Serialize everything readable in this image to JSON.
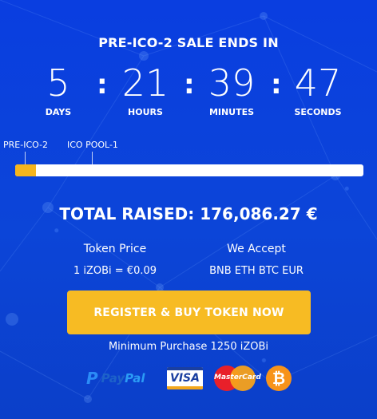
{
  "heading": "PRE-ICO-2 SALE ENDS IN",
  "countdown": {
    "days": {
      "value": "5",
      "label": "DAYS"
    },
    "hours": {
      "value": "21",
      "label": "HOURS"
    },
    "minutes": {
      "value": "39",
      "label": "MINUTES"
    },
    "seconds": {
      "value": "47",
      "label": "SECONDS"
    },
    "separator": ":"
  },
  "stages": [
    "PRE-ICO-2",
    "ICO POOL-1"
  ],
  "progress": {
    "fraction": 0.06,
    "fill_color": "#f6b51d",
    "track_color": "#ffffff"
  },
  "total_raised": "TOTAL RAISED: 176,086.27 €",
  "token_price": {
    "title": "Token Price",
    "value": "1 iZOBi = €0.09"
  },
  "accept": {
    "title": "We Accept",
    "value": "BNB ETH BTC EUR"
  },
  "cta_label": "REGISTER & BUY TOKEN NOW",
  "min_purchase": "Minimum Purchase 1250 iZOBi",
  "payments": {
    "paypal": {
      "pay": "Pay",
      "pal": "Pal"
    },
    "visa": "VISA",
    "mastercard": "MasterCard",
    "bitcoin": "₿"
  },
  "colors": {
    "background": "#0b3fd8",
    "accent": "#f7bb23"
  }
}
